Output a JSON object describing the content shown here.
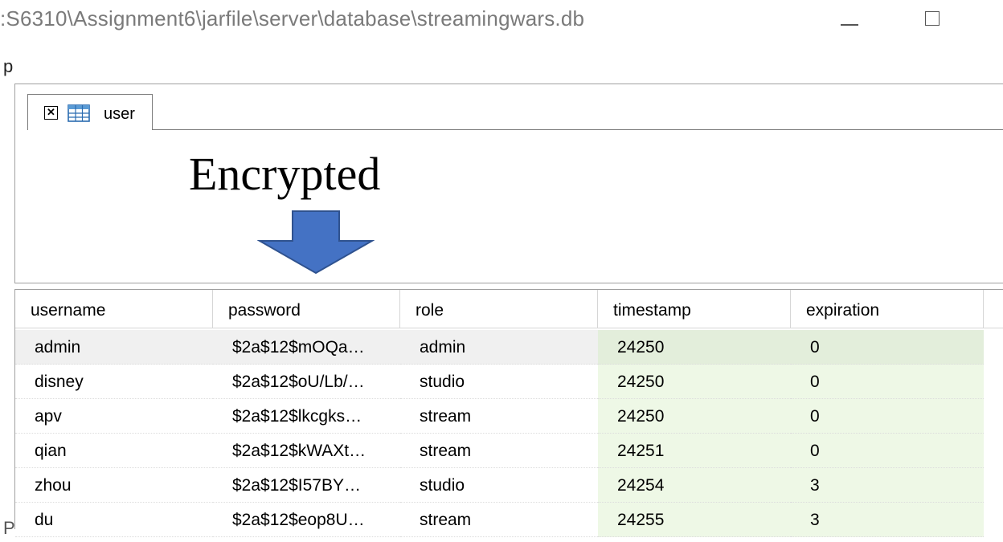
{
  "window": {
    "title": ":S6310\\Assignment6\\jarfile\\server\\database\\streamingwars.db",
    "menu_fragment": "p",
    "bottom_fragment": "P"
  },
  "tab": {
    "label": "user",
    "close_glyph": "✕",
    "icon": "table-grid-icon"
  },
  "annotation": {
    "label": "Encrypted",
    "arrow_color": "#4472c4",
    "arrow_stroke": "#2f528f",
    "icon": "down-arrow-icon"
  },
  "grid": {
    "columns": [
      "username",
      "password",
      "role",
      "timestamp",
      "expiration"
    ],
    "rows": [
      [
        "admin",
        "$2a$12$mOQa…",
        "admin",
        "24250",
        "0"
      ],
      [
        "disney",
        "$2a$12$oU/Lb/…",
        "studio",
        "24250",
        "0"
      ],
      [
        "apv",
        "$2a$12$lkcgks…",
        "stream",
        "24250",
        "0"
      ],
      [
        "qian",
        "$2a$12$kWAXt…",
        "stream",
        "24251",
        "0"
      ],
      [
        "zhou",
        "$2a$12$I57BY…",
        "studio",
        "24254",
        "3"
      ],
      [
        "du",
        "$2a$12$eop8U…",
        "stream",
        "24255",
        "3"
      ]
    ],
    "selected_row": 0,
    "highlight_color": "#eef8e6"
  }
}
